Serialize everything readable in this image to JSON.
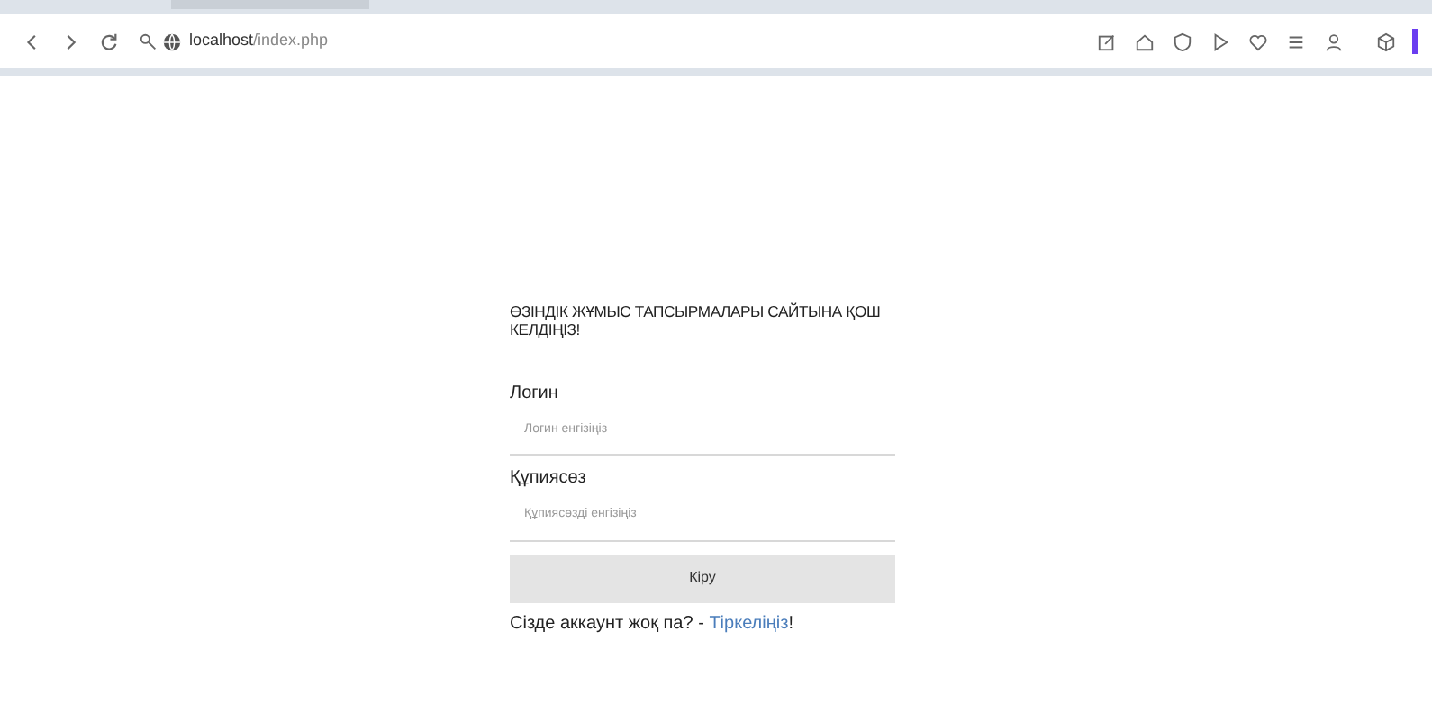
{
  "browser": {
    "url_host": "localhost",
    "url_path": "/index.php"
  },
  "form": {
    "title": "ӨЗІНДІК ЖҰМЫС ТАПСЫРМАЛАРЫ САЙТЫНА ҚОШ КЕЛДІҢІЗ!",
    "fields": [
      {
        "label": "Логин",
        "placeholder": "Логин енгізіңіз"
      },
      {
        "label": "Құпиясөз",
        "placeholder": "Құпиясөзді енгізіңіз"
      }
    ],
    "submit": "Кіру",
    "signup_prompt": "Сізде аккаунт жоқ па? - ",
    "signup_link": "Тіркеліңіз",
    "signup_end": "!"
  }
}
